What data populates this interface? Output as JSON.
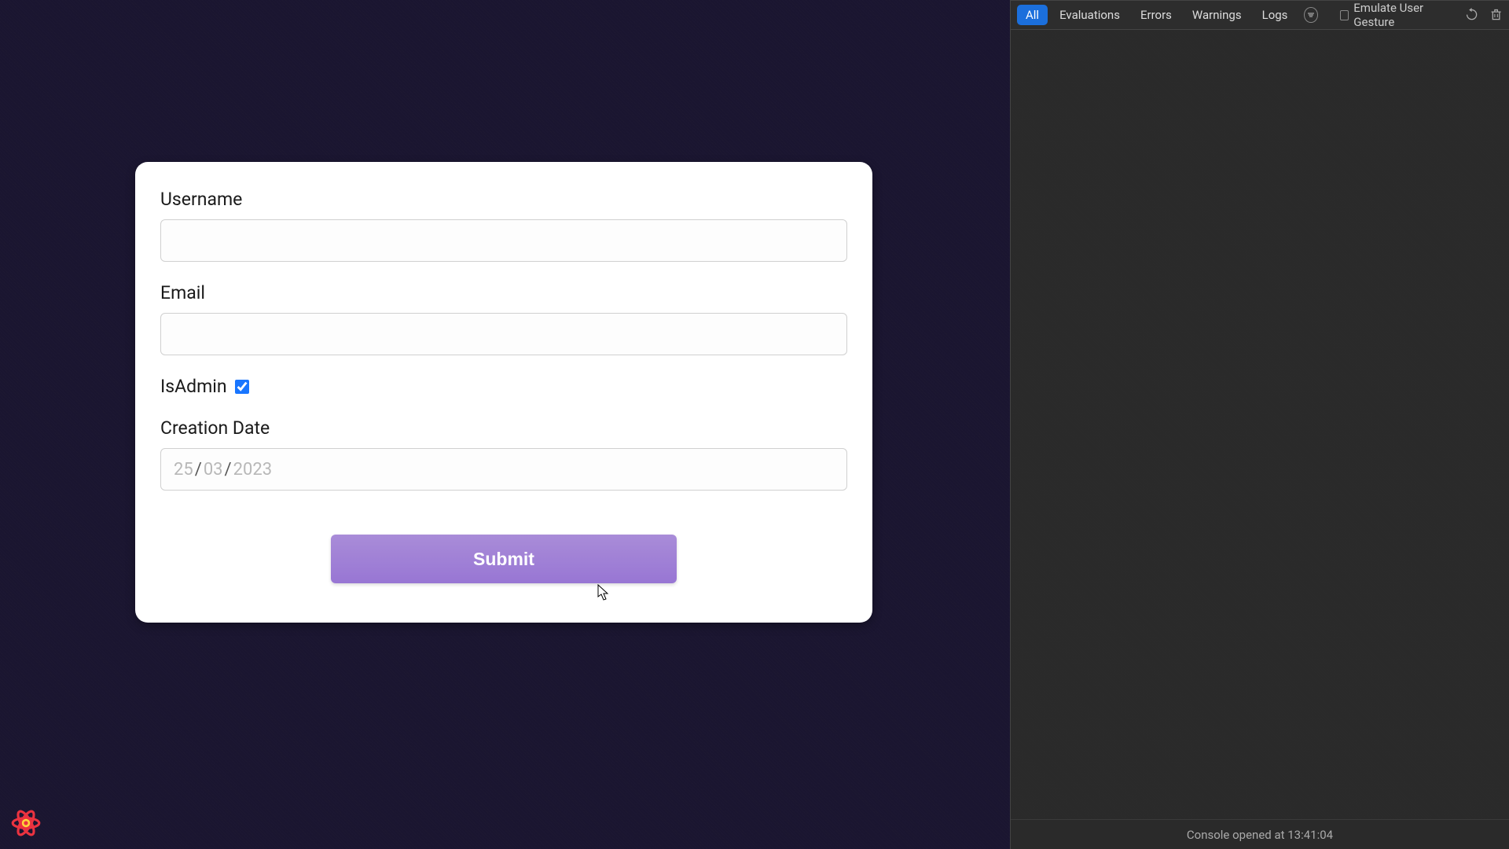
{
  "form": {
    "username": {
      "label": "Username",
      "value": ""
    },
    "email": {
      "label": "Email",
      "value": ""
    },
    "isAdmin": {
      "label": "IsAdmin",
      "checked": true
    },
    "creationDate": {
      "label": "Creation Date",
      "day": "25",
      "month": "03",
      "year": "2023"
    },
    "submit": {
      "label": "Submit"
    }
  },
  "devtools": {
    "filters": {
      "all": "All",
      "evaluations": "Evaluations",
      "errors": "Errors",
      "warnings": "Warnings",
      "logs": "Logs"
    },
    "emulate": {
      "label": "Emulate User Gesture"
    },
    "footer": "Console opened at 13:41:04"
  }
}
